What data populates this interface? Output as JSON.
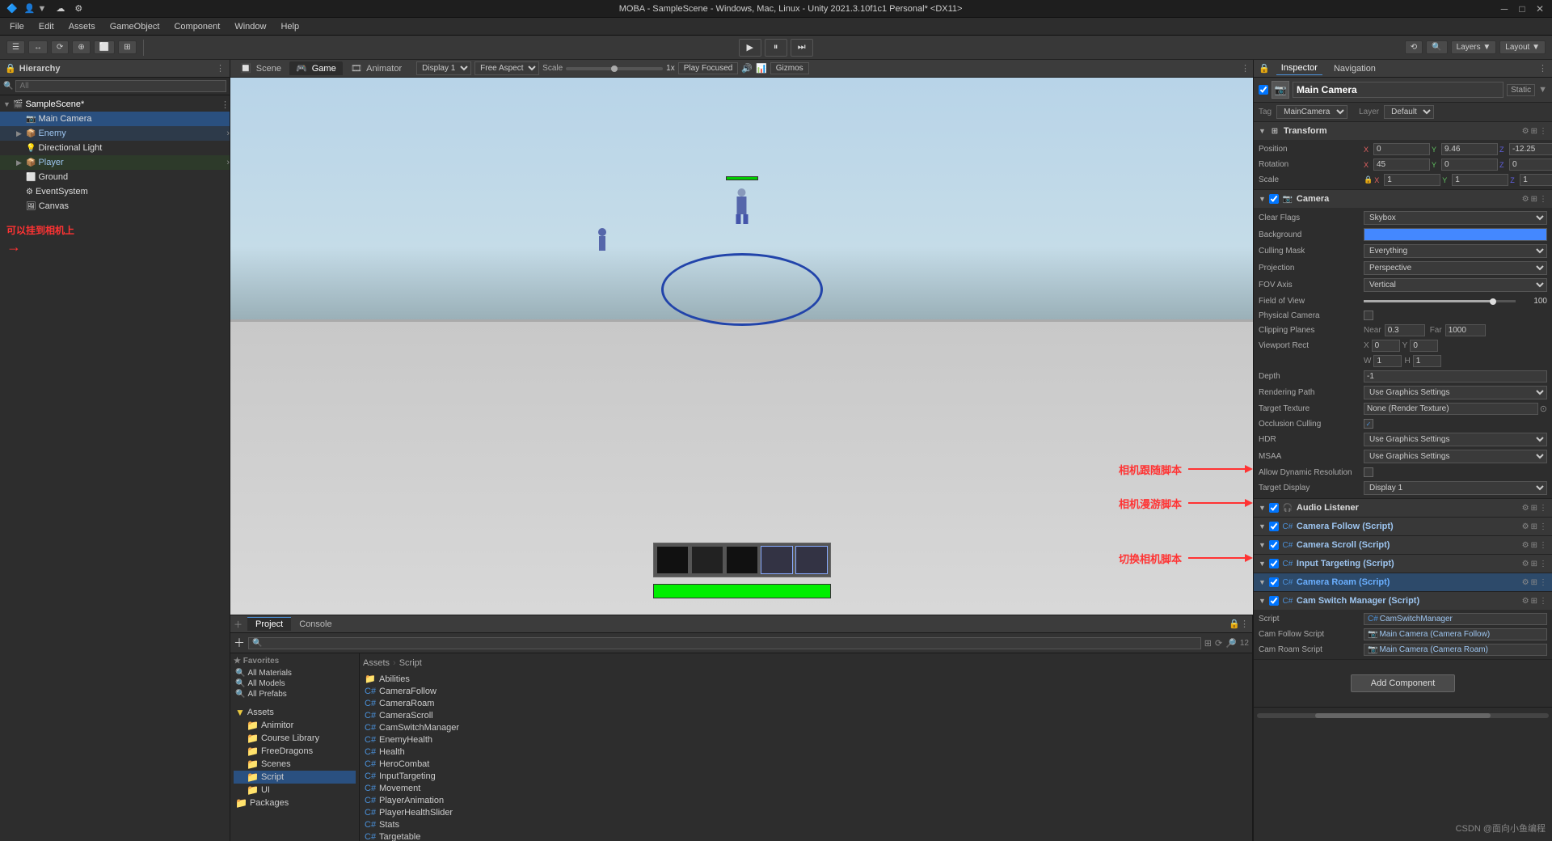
{
  "titlebar": {
    "title": "MOBA - SampleScene - Windows, Mac, Linux - Unity 2021.3.10f1c1 Personal* <DX11>",
    "controls": [
      "─",
      "□",
      "✕"
    ]
  },
  "menubar": {
    "items": [
      "File",
      "Edit",
      "Assets",
      "GameObject",
      "Component",
      "Window",
      "Help"
    ]
  },
  "toolbar": {
    "left_buttons": [
      "☰",
      "◁",
      "⬤",
      "⊕"
    ],
    "play": "▶",
    "pause": "⏸",
    "step": "⏭",
    "right_items": [
      "Layers",
      "Layout"
    ]
  },
  "hierarchy": {
    "title": "Hierarchy",
    "search_placeholder": "All",
    "items": [
      {
        "label": "SampleScene*",
        "level": 0,
        "type": "scene",
        "has_arrow": true
      },
      {
        "label": "Main Camera",
        "level": 1,
        "type": "camera",
        "has_arrow": false,
        "selected": true
      },
      {
        "label": "Enemy",
        "level": 1,
        "type": "prefab",
        "has_arrow": true
      },
      {
        "label": "Directional Light",
        "level": 1,
        "type": "light",
        "has_arrow": false
      },
      {
        "label": "Player",
        "level": 1,
        "type": "prefab",
        "has_arrow": true
      },
      {
        "label": "Ground",
        "level": 1,
        "type": "object",
        "has_arrow": false
      },
      {
        "label": "EventSystem",
        "level": 1,
        "type": "object",
        "has_arrow": false
      },
      {
        "label": "Canvas",
        "level": 1,
        "type": "object",
        "has_arrow": false
      }
    ]
  },
  "view_tabs": {
    "tabs": [
      "Scene",
      "Game",
      "Animator"
    ],
    "active": "Game",
    "game_controls": {
      "display": "Display 1",
      "aspect": "Free Aspect",
      "scale_label": "Scale",
      "scale_value": "1x",
      "play_focused": "Play Focused",
      "gizmos": "Gizmos"
    }
  },
  "inspector": {
    "title": "Inspector",
    "tabs": [
      "Inspector",
      "Navigation"
    ],
    "object": {
      "name": "Main Camera",
      "static_label": "Static",
      "tag": "MainCamera",
      "layer": "Default"
    },
    "transform": {
      "title": "Transform",
      "position": {
        "x": "0",
        "y": "9.46",
        "z": "-12.25"
      },
      "rotation": {
        "x": "45",
        "y": "0",
        "z": "0"
      },
      "scale": {
        "x": "1",
        "y": "1",
        "z": "1"
      }
    },
    "camera": {
      "title": "Camera",
      "clear_flags": "Skybox",
      "culling_mask": "Everything",
      "projection": "Perspective",
      "fov_axis": "Vertical",
      "field_of_view": "100",
      "fov_percent": 85,
      "physical_camera": false,
      "clipping_near": "0.3",
      "clipping_far": "1000",
      "viewport_x": "0",
      "viewport_y": "0",
      "viewport_w": "1",
      "viewport_h": "1",
      "depth": "-1",
      "rendering_path": "Use Graphics Settings",
      "target_texture": "None (Render Texture)",
      "occlusion_culling": true,
      "hdr": "Use Graphics Settings",
      "msaa": "Use Graphics Settings",
      "allow_dynamic_resolution": false,
      "target_display": "Display 1"
    },
    "audio_listener": {
      "title": "Audio Listener"
    },
    "camera_follow": {
      "title": "Camera Follow (Script)",
      "script_name": "CameraFollow"
    },
    "camera_scroll": {
      "title": "Camera Scroll (Script)",
      "script_name": "CameraScroll"
    },
    "input_targeting": {
      "title": "Input Targeting (Script)",
      "script_name": "InputTargeting"
    },
    "camera_roam": {
      "title": "Camera Roam (Script)",
      "script_name": "CameraRoam",
      "highlighted": true
    },
    "cam_switch_manager": {
      "title": "Cam Switch Manager (Script)",
      "script_name": "CamSwitchManager",
      "script_field": "CamSwitchManager",
      "cam_follow_label": "Cam Follow Script",
      "cam_follow_value": "Main Camera (Camera Follow)",
      "cam_roam_label": "Cam Roam Script",
      "cam_roam_value": "Main Camera (Camera Roam)"
    },
    "add_component": "Add Component"
  },
  "project": {
    "tabs": [
      "Project",
      "Console"
    ],
    "active_tab": "Project",
    "favorites": {
      "title": "Favorites",
      "items": [
        "All Materials",
        "All Models",
        "All Prefabs"
      ]
    },
    "assets": {
      "title": "Assets",
      "folders": [
        "Animitor",
        "Course Library",
        "FreeDragons",
        "Scenes",
        "Script",
        "UI",
        "Packages"
      ],
      "selected": "Script",
      "breadcrumb": [
        "Assets",
        "Script"
      ],
      "files": [
        "Abilities",
        "CameraFollow",
        "CameraRoam",
        "CameraScroll",
        "CamSwitchManager",
        "EnemyHealth",
        "Health",
        "HeroCombat",
        "InputTargeting",
        "Movement",
        "PlayerAnimation",
        "PlayerHealthSlider",
        "Stats",
        "Targetable"
      ]
    }
  },
  "annotations": {
    "camera_attach": "可以挂到相机上",
    "camera_follow": "相机跟随脚本",
    "camera_roam": "相机漫游脚本",
    "cam_switch": "切换相机脚本"
  }
}
